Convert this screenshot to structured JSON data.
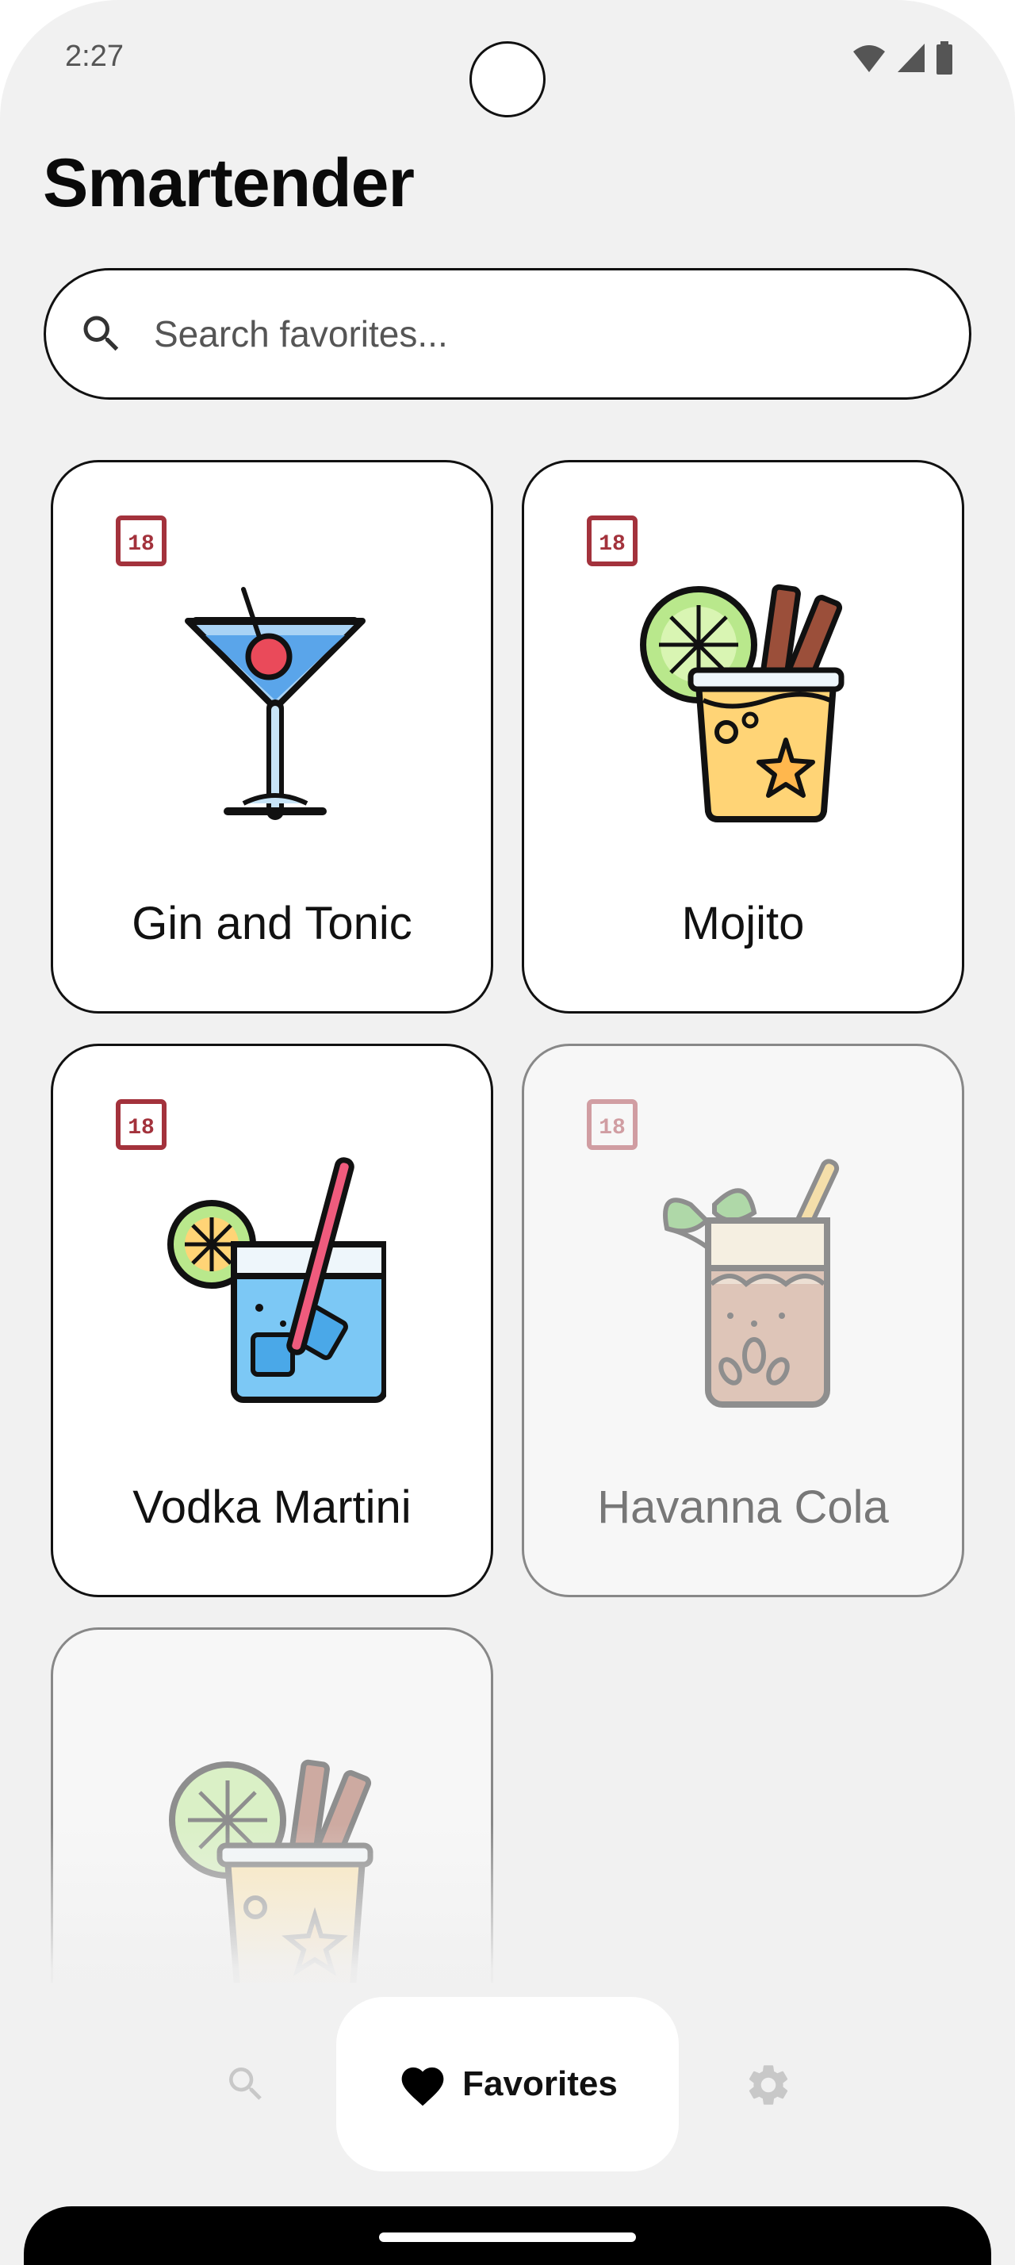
{
  "status_bar": {
    "time": "2:27"
  },
  "app": {
    "title": "Smartender"
  },
  "search": {
    "placeholder": "Search favorites..."
  },
  "cards": [
    {
      "label": "Gin and Tonic",
      "badge": "18"
    },
    {
      "label": "Mojito",
      "badge": "18"
    },
    {
      "label": "Vodka Martini",
      "badge": "18"
    },
    {
      "label": "Havanna Cola",
      "badge": "18"
    },
    {
      "label": "",
      "badge": ""
    }
  ],
  "bottom_nav": {
    "items": [
      {
        "icon": "search-icon"
      },
      {
        "icon": "heart-icon",
        "label": "Favorites",
        "selected": true
      },
      {
        "icon": "gear-icon"
      }
    ]
  },
  "colors": {
    "background": "#f1f1f1",
    "badge_red": "#a3323c",
    "card_border": "#111111"
  }
}
